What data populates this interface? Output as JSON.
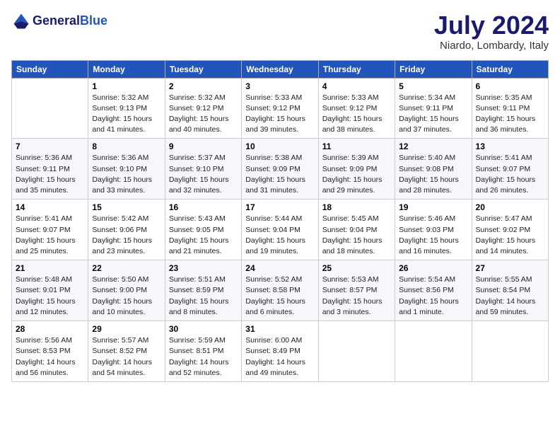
{
  "header": {
    "logo_general": "General",
    "logo_blue": "Blue",
    "month_year": "July 2024",
    "location": "Niardo, Lombardy, Italy"
  },
  "columns": [
    "Sunday",
    "Monday",
    "Tuesday",
    "Wednesday",
    "Thursday",
    "Friday",
    "Saturday"
  ],
  "weeks": [
    [
      {
        "day": "",
        "detail": ""
      },
      {
        "day": "1",
        "detail": "Sunrise: 5:32 AM\nSunset: 9:13 PM\nDaylight: 15 hours\nand 41 minutes."
      },
      {
        "day": "2",
        "detail": "Sunrise: 5:32 AM\nSunset: 9:12 PM\nDaylight: 15 hours\nand 40 minutes."
      },
      {
        "day": "3",
        "detail": "Sunrise: 5:33 AM\nSunset: 9:12 PM\nDaylight: 15 hours\nand 39 minutes."
      },
      {
        "day": "4",
        "detail": "Sunrise: 5:33 AM\nSunset: 9:12 PM\nDaylight: 15 hours\nand 38 minutes."
      },
      {
        "day": "5",
        "detail": "Sunrise: 5:34 AM\nSunset: 9:11 PM\nDaylight: 15 hours\nand 37 minutes."
      },
      {
        "day": "6",
        "detail": "Sunrise: 5:35 AM\nSunset: 9:11 PM\nDaylight: 15 hours\nand 36 minutes."
      }
    ],
    [
      {
        "day": "7",
        "detail": "Sunrise: 5:36 AM\nSunset: 9:11 PM\nDaylight: 15 hours\nand 35 minutes."
      },
      {
        "day": "8",
        "detail": "Sunrise: 5:36 AM\nSunset: 9:10 PM\nDaylight: 15 hours\nand 33 minutes."
      },
      {
        "day": "9",
        "detail": "Sunrise: 5:37 AM\nSunset: 9:10 PM\nDaylight: 15 hours\nand 32 minutes."
      },
      {
        "day": "10",
        "detail": "Sunrise: 5:38 AM\nSunset: 9:09 PM\nDaylight: 15 hours\nand 31 minutes."
      },
      {
        "day": "11",
        "detail": "Sunrise: 5:39 AM\nSunset: 9:09 PM\nDaylight: 15 hours\nand 29 minutes."
      },
      {
        "day": "12",
        "detail": "Sunrise: 5:40 AM\nSunset: 9:08 PM\nDaylight: 15 hours\nand 28 minutes."
      },
      {
        "day": "13",
        "detail": "Sunrise: 5:41 AM\nSunset: 9:07 PM\nDaylight: 15 hours\nand 26 minutes."
      }
    ],
    [
      {
        "day": "14",
        "detail": "Sunrise: 5:41 AM\nSunset: 9:07 PM\nDaylight: 15 hours\nand 25 minutes."
      },
      {
        "day": "15",
        "detail": "Sunrise: 5:42 AM\nSunset: 9:06 PM\nDaylight: 15 hours\nand 23 minutes."
      },
      {
        "day": "16",
        "detail": "Sunrise: 5:43 AM\nSunset: 9:05 PM\nDaylight: 15 hours\nand 21 minutes."
      },
      {
        "day": "17",
        "detail": "Sunrise: 5:44 AM\nSunset: 9:04 PM\nDaylight: 15 hours\nand 19 minutes."
      },
      {
        "day": "18",
        "detail": "Sunrise: 5:45 AM\nSunset: 9:04 PM\nDaylight: 15 hours\nand 18 minutes."
      },
      {
        "day": "19",
        "detail": "Sunrise: 5:46 AM\nSunset: 9:03 PM\nDaylight: 15 hours\nand 16 minutes."
      },
      {
        "day": "20",
        "detail": "Sunrise: 5:47 AM\nSunset: 9:02 PM\nDaylight: 15 hours\nand 14 minutes."
      }
    ],
    [
      {
        "day": "21",
        "detail": "Sunrise: 5:48 AM\nSunset: 9:01 PM\nDaylight: 15 hours\nand 12 minutes."
      },
      {
        "day": "22",
        "detail": "Sunrise: 5:50 AM\nSunset: 9:00 PM\nDaylight: 15 hours\nand 10 minutes."
      },
      {
        "day": "23",
        "detail": "Sunrise: 5:51 AM\nSunset: 8:59 PM\nDaylight: 15 hours\nand 8 minutes."
      },
      {
        "day": "24",
        "detail": "Sunrise: 5:52 AM\nSunset: 8:58 PM\nDaylight: 15 hours\nand 6 minutes."
      },
      {
        "day": "25",
        "detail": "Sunrise: 5:53 AM\nSunset: 8:57 PM\nDaylight: 15 hours\nand 3 minutes."
      },
      {
        "day": "26",
        "detail": "Sunrise: 5:54 AM\nSunset: 8:56 PM\nDaylight: 15 hours\nand 1 minute."
      },
      {
        "day": "27",
        "detail": "Sunrise: 5:55 AM\nSunset: 8:54 PM\nDaylight: 14 hours\nand 59 minutes."
      }
    ],
    [
      {
        "day": "28",
        "detail": "Sunrise: 5:56 AM\nSunset: 8:53 PM\nDaylight: 14 hours\nand 56 minutes."
      },
      {
        "day": "29",
        "detail": "Sunrise: 5:57 AM\nSunset: 8:52 PM\nDaylight: 14 hours\nand 54 minutes."
      },
      {
        "day": "30",
        "detail": "Sunrise: 5:59 AM\nSunset: 8:51 PM\nDaylight: 14 hours\nand 52 minutes."
      },
      {
        "day": "31",
        "detail": "Sunrise: 6:00 AM\nSunset: 8:49 PM\nDaylight: 14 hours\nand 49 minutes."
      },
      {
        "day": "",
        "detail": ""
      },
      {
        "day": "",
        "detail": ""
      },
      {
        "day": "",
        "detail": ""
      }
    ]
  ]
}
